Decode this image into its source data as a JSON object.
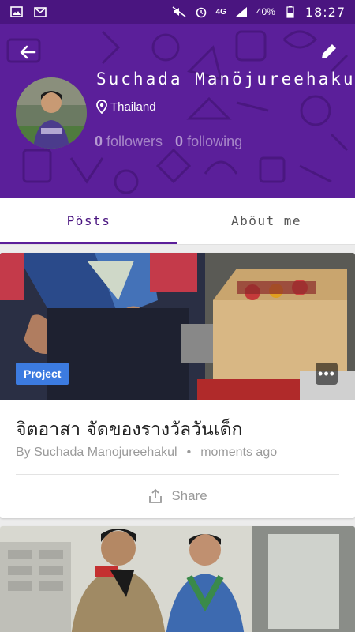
{
  "status_bar": {
    "network": "4G",
    "battery": "40%",
    "time": "18:27"
  },
  "profile": {
    "name": "Suchada Manöjureehakul",
    "location": "Thailand",
    "followers_count": "0",
    "followers_label": "followers",
    "following_count": "0",
    "following_label": "following"
  },
  "tabs": [
    {
      "label": "Pösts",
      "active": true
    },
    {
      "label": "Aböut me",
      "active": false
    }
  ],
  "posts": [
    {
      "badge": "Project",
      "title": "จิตอาสา จัดของรางวัลวันเด็ก",
      "author": "By Suchada Manojureehakul",
      "time": "moments ago",
      "share_label": "Share"
    }
  ],
  "colors": {
    "header": "#5b1f9a",
    "status_bar": "#4a1580",
    "badge": "#3c7be0"
  }
}
